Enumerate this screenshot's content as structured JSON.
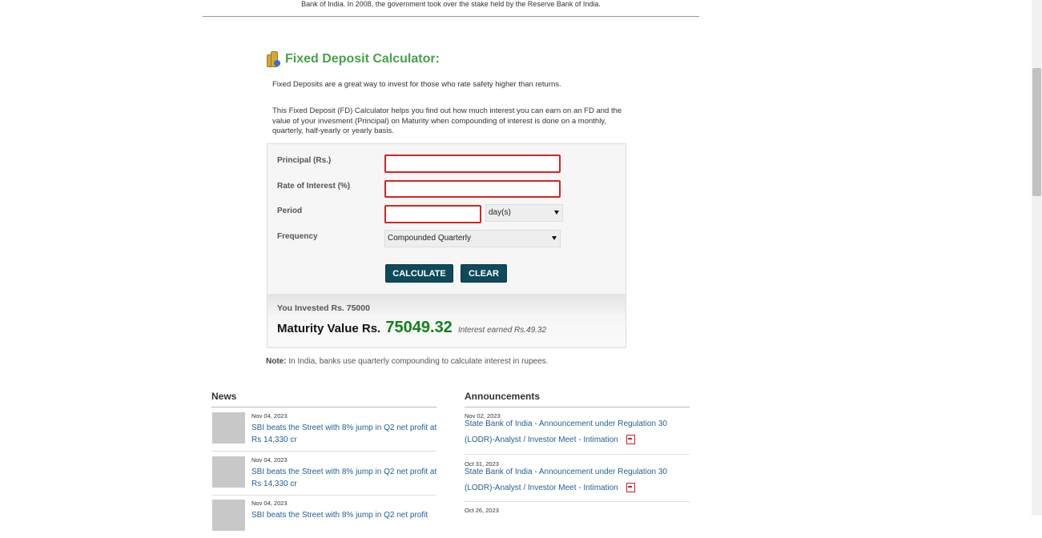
{
  "top_text": "Bank of India. In 2008, the government took over the stake held by the Reserve Bank of India.",
  "calculator": {
    "title": "Fixed Deposit Calculator:",
    "intro": "Fixed Deposits are a great way to invest for those who rate safety higher than returns.",
    "description": "This Fixed Deposit (FD) Calculator helps you find out how much interest you can earn on an FD and the value of your invesment (Principal) on Maturity when compounding of interest is done on a monthly, quarterly, half-yearly or yearly basis.",
    "principal_label": "Principal (Rs.)",
    "principal_value": "",
    "rate_label": "Rate of Interest (%)",
    "rate_value": "",
    "period_label": "Period",
    "period_value": "",
    "period_unit": "day(s)",
    "frequency_label": "Frequency",
    "frequency_value": "Compounded Quarterly",
    "calculate_label": "CALCULATE",
    "clear_label": "CLEAR",
    "invested_text": "You Invested Rs. 75000",
    "maturity_label": "Maturity Value Rs.",
    "maturity_value": "75049.32",
    "interest_text": "Interest earned Rs.49.32",
    "note_label": "Note:",
    "note_text": "In India, banks use quarterly compounding to calculate interest in rupees."
  },
  "news": {
    "title": "News",
    "items": [
      {
        "date": "Nov 04, 2023",
        "headline": "SBI beats the Street with 8% jump in Q2 net profit at Rs 14,330 cr"
      },
      {
        "date": "Nov 04, 2023",
        "headline": "SBI beats the Street with 8% jump in Q2 net profit at Rs 14,330 cr"
      },
      {
        "date": "Nov 04, 2023",
        "headline": "SBI beats the Street with 8% jump in Q2 net profit"
      }
    ]
  },
  "announcements": {
    "title": "Announcements",
    "items": [
      {
        "date": "Nov 02, 2023",
        "text": "State Bank of India - Announcement under Regulation 30 (LODR)-Analyst / Investor Meet - Intimation"
      },
      {
        "date": "Oct 31, 2023",
        "text": "State Bank of India - Announcement under Regulation 30 (LODR)-Analyst / Investor Meet - Intimation"
      },
      {
        "date": "Oct 26, 2023",
        "text": ""
      }
    ]
  },
  "colors": {
    "accent_green": "#45a348",
    "maturity_green": "#11821c",
    "button": "#0e4a5a",
    "error_border": "#d42424",
    "link": "#1f5e9e"
  }
}
